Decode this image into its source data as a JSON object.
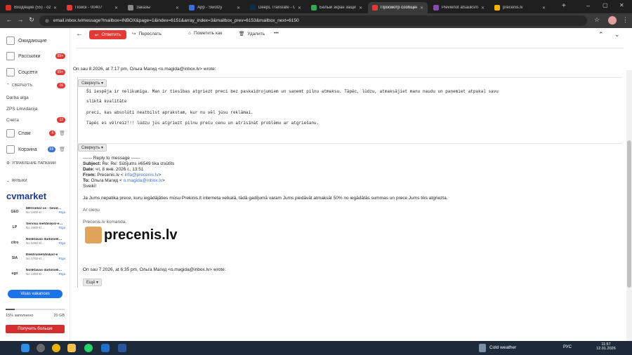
{
  "tabs": [
    {
      "label": "Входящие (55) - ozy…",
      "color": "#d93025",
      "active": false
    },
    {
      "label": "Поиск - 00407",
      "color": "#e53935",
      "active": false
    },
    {
      "label": "Заказы",
      "color": "#888888",
      "active": false
    },
    {
      "label": "App - Swotzy",
      "color": "#3b6fd8",
      "active": false
    },
    {
      "label": "DeepL Translate - Co…",
      "color": "#0f2b46",
      "active": false
    },
    {
      "label": "Белый экран защиты…",
      "color": "#34a853",
      "active": false
    },
    {
      "label": "Просмотр сообщения…",
      "color": "#e53935",
      "active": true
    },
    {
      "label": "Pievienot atsauksmi –…",
      "color": "#8a4baf",
      "active": false
    },
    {
      "label": "precenis.lv",
      "color": "#f4b400",
      "active": false
    }
  ],
  "address_bar": "email.inbox.lv/message?mailbox=INBOX&page=1&index=6151&array_index=3&mailbox_prev=6153&mailbox_next=6150",
  "sidebar": {
    "folders": [
      {
        "label": "Ожидающие",
        "badge": ""
      },
      {
        "label": "Рассылки",
        "badge": "99+"
      },
      {
        "label": "Соцсети",
        "badge": "99+"
      }
    ],
    "collapse_label": "СВЕРНУТЬ",
    "collapse_badge": "16",
    "subfolders": [
      {
        "label": "Darba alga",
        "badge": ""
      },
      {
        "label": "ZPS Likvidacija",
        "badge": ""
      },
      {
        "label": "Счета",
        "badge": "12"
      }
    ],
    "spam": {
      "label": "Спам",
      "badge": "4"
    },
    "trash": {
      "label": "Корзина",
      "badge": "59"
    },
    "manage_folders": "УПРАВЛЕНИЕ ПАПКАМИ",
    "labels": "ЯРЛЫКИ",
    "cv_brand": "cvmarket",
    "jobs": [
      {
        "logo": "GEO",
        "title": "Mērnieks/-ce - Geod…",
        "salary": "No 1400 €/…",
        "city": "Rīga"
      },
      {
        "logo": "LP",
        "title": "Servisa mehāniķis/-e…",
        "salary": "No 1900 €/…",
        "city": "Rīga"
      },
      {
        "logo": "citro",
        "title": "Noliktavas darbiniek…",
        "salary": "No 1260 €/…",
        "city": "Rīga"
      },
      {
        "logo": "SIA",
        "title": "Elektromehāniķis/-e",
        "salary": "No 1700 €/…",
        "city": "Rīga"
      },
      {
        "logo": "ego",
        "title": "Noliktavas darbiniek…",
        "salary": "No 1300 €/…",
        "city": "Rīga"
      }
    ],
    "all_vacancies": "Visas vakances",
    "storage_used": "15% заполнено",
    "storage_total": "20 GB",
    "storage_fraction": 0.15,
    "get_more": "Получить больше"
  },
  "mail_toolbar": {
    "reply": "Ответить",
    "forward": "Переслать",
    "mark_as": "Пометить как",
    "delete": "Удалить",
    "more": "•••"
  },
  "message": {
    "wrote_line_1": "On sau 8 2026, at 7:17 pm, Ольга Магид <o.magida@inbox.lv> wrote:",
    "collapse_1": "Свернуть",
    "body_lines": [
      "Šī iespēja ir nelikumīga. Man ir tiesības atgriezt preci bez paskaidrojumiem un saņemt pilnu atmaksu. Tāpēc, lūdzu, atmaksājiet manu naudu un paņemiet atpakaļ savu",
      "sliktā kvalitāte",
      " preci, kas absolūti neatbilst aprakstam, kur nu vēl jūsu reklāmai.",
      "Tāpēc es vēlreiz!!! lūdzu jūs atgriezt pilnu preču cenu un atrisināt problēmu ar atgriešanu."
    ],
    "collapse_2": "Свернуть",
    "reply_header": "------ Reply to message ------",
    "subject_label": "Subject:",
    "subject": "Re: Re: Sūtījums #6549 tika izsūtīts",
    "date_label": "Date:",
    "date": "чт, 8 янв. 2026 г., 13:51",
    "from_label": "From:",
    "from_name": "Precenis.lv <",
    "from_email": "info@precenis.lv",
    "from_end": ">",
    "to_label": "To:",
    "to_name": "Ольга Магид <",
    "to_email": "o.magida@inbox.lv",
    "to_end": ">",
    "greeting": "Sveiki!",
    "reply_body": "Ja Jums nepatika prece, kuru iegādājāties mūsu Prekinis.lt interneta veikalā, tādā gadījumā varam Jums piedāvāt atmaksāt 50% no iegādātās summas un prece Jums tiks atgriezta.",
    "regards": "Ar cieņu",
    "team": "Precenis.lv komanda.",
    "brand_logo_text": "precenis.lv",
    "wrote_line_2": "On sau 7 2026, at 6:35 pm, Ольга Магид <o.magida@inbox.lv> wrote:",
    "more_button": "Ещё"
  },
  "taskbar": {
    "weather": "Cold weather",
    "lang": "РУС",
    "time": "11:57",
    "date": "12.01.2026"
  },
  "colors": {
    "accent": "#e53935",
    "link": "#3b6fd8",
    "chrome_dark": "#1f1f1f"
  }
}
